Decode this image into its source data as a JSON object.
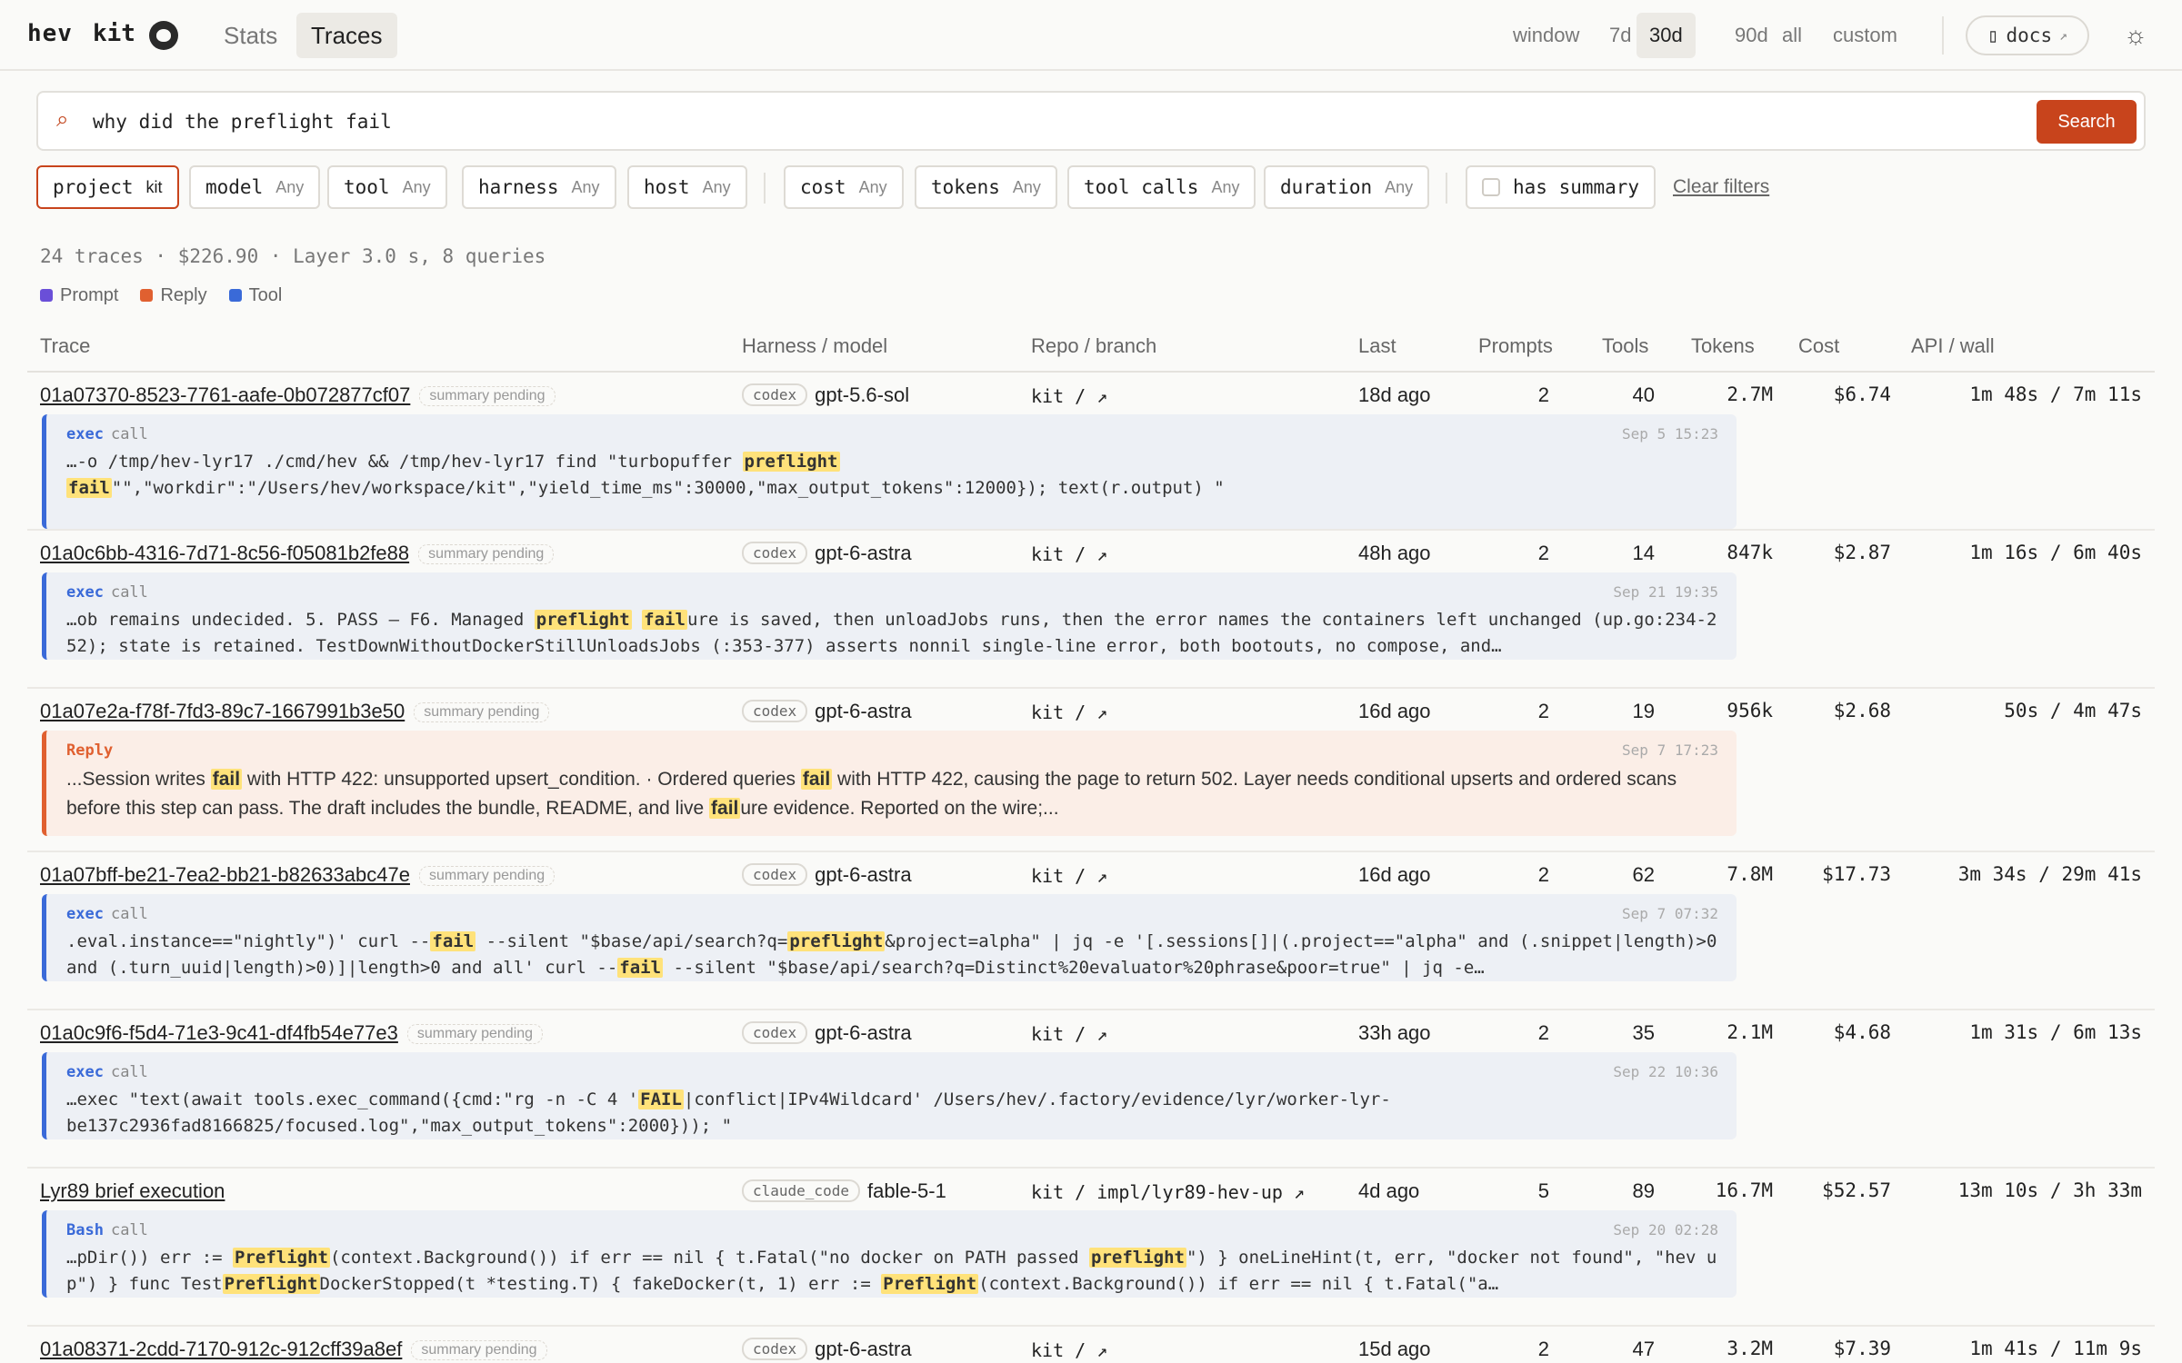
{
  "brand": {
    "name": "hev",
    "project": "kit",
    "github_icon": "github-icon"
  },
  "nav": {
    "stats": "Stats",
    "traces": "Traces"
  },
  "window": {
    "label": "window",
    "options": [
      "7d",
      "30d",
      "90d",
      "all",
      "custom"
    ],
    "active": "30d"
  },
  "docs": {
    "label": "docs",
    "icon": "book-icon",
    "ext": "↗"
  },
  "theme_icon": "sun-icon",
  "search": {
    "value": "why did the preflight fail",
    "button": "Search",
    "icon": "search-icon"
  },
  "filters": [
    {
      "key": "project",
      "value": "kit",
      "active": true
    },
    {
      "key": "model",
      "value": "Any"
    },
    {
      "key": "tool",
      "value": "Any"
    },
    {
      "key": "harness",
      "value": "Any"
    },
    {
      "key": "host",
      "value": "Any"
    },
    {
      "key": "cost",
      "value": "Any"
    },
    {
      "key": "tokens",
      "value": "Any"
    },
    {
      "key": "tool calls",
      "value": "Any"
    },
    {
      "key": "duration",
      "value": "Any"
    }
  ],
  "has_summary": "has summary",
  "clear_filters": "Clear filters",
  "summary": "24 traces · $226.90 · Layer 3.0 s, 8 queries",
  "legend": [
    {
      "label": "Prompt",
      "color": "#6a4fd8"
    },
    {
      "label": "Reply",
      "color": "#e06030"
    },
    {
      "label": "Tool",
      "color": "#3a6ad8"
    }
  ],
  "columns": [
    "Trace",
    "Harness / model",
    "Repo / branch",
    "Last",
    "Prompts",
    "Tools",
    "Tokens",
    "Cost",
    "API / wall"
  ],
  "rows": [
    {
      "id": "01a07370-8523-7761-aafe-0b072877cf07",
      "pending": "summary pending",
      "harness": "codex",
      "model": "gpt-5.6-sol",
      "repo": "kit / ↗",
      "last": "18d ago",
      "prompts": "2",
      "tools": "40",
      "tokens": "2.7M",
      "cost": "$6.74",
      "time": "1m 48s / 7m 11s",
      "snippet": {
        "kind": "exec",
        "sub": "call",
        "ts": "Sep 5 15:23",
        "reply": false,
        "text": [
          "…-o /tmp/hev-lyr17 ./cmd/hev && /tmp/hev-lyr17 find \"turbopuffer ",
          {
            "h": "preflight"
          },
          "\n",
          {
            "h": "fail"
          },
          "\"\",\"workdir\":\"/Users/hev/workspace/kit\",\"yield_time_ms\":30000,\"max_output_tokens\":12000}); text(r.output) \""
        ]
      }
    },
    {
      "id": "01a0c6bb-4316-7d71-8c56-f05081b2fe88",
      "pending": "summary pending",
      "harness": "codex",
      "model": "gpt-6-astra",
      "repo": "kit / ↗",
      "last": "48h ago",
      "prompts": "2",
      "tools": "14",
      "tokens": "847k",
      "cost": "$2.87",
      "time": "1m 16s / 6m 40s",
      "snippet": {
        "kind": "exec",
        "sub": "call",
        "ts": "Sep 21 19:35",
        "reply": false,
        "text": [
          "…ob remains undecided. 5. PASS — F6. Managed ",
          {
            "h": "preflight"
          },
          " ",
          {
            "h": "fail"
          },
          "ure is saved, then unloadJobs runs, then the error names the containers left unchanged (up.go:234-252); state is retained. TestDownWithoutDockerStillUnloadsJobs (:353-377) asserts nonnil single-line error, both bootouts, no compose, and…"
        ]
      }
    },
    {
      "id": "01a07e2a-f78f-7fd3-89c7-1667991b3e50",
      "pending": "summary pending",
      "harness": "codex",
      "model": "gpt-6-astra",
      "repo": "kit / ↗",
      "last": "16d ago",
      "prompts": "2",
      "tools": "19",
      "tokens": "956k",
      "cost": "$2.68",
      "time": "50s / 4m 47s",
      "snippet": {
        "kind": "Reply",
        "sub": "",
        "ts": "Sep 7 17:23",
        "reply": true,
        "text": [
          "...Session writes ",
          {
            "h": "fail"
          },
          " with HTTP 422: unsupported upsert_condition. · Ordered queries ",
          {
            "h": "fail"
          },
          " with HTTP 422, causing the page to return 502. Layer needs conditional upserts and ordered scans before this step can pass. The draft includes the bundle, README, and live ",
          {
            "h": "fail"
          },
          "ure evidence. Reported on the wire;..."
        ]
      }
    },
    {
      "id": "01a07bff-be21-7ea2-bb21-b82633abc47e",
      "pending": "summary pending",
      "harness": "codex",
      "model": "gpt-6-astra",
      "repo": "kit / ↗",
      "last": "16d ago",
      "prompts": "2",
      "tools": "62",
      "tokens": "7.8M",
      "cost": "$17.73",
      "time": "3m 34s / 29m 41s",
      "snippet": {
        "kind": "exec",
        "sub": "call",
        "ts": "Sep 7 07:32",
        "reply": false,
        "text": [
          ".eval.instance==\"nightly\")' curl --",
          {
            "h": "fail"
          },
          " --silent \"$base/api/search?q=",
          {
            "h": "preflight"
          },
          "&project=alpha\" | jq -e '[.sessions[]|(.project==\"alpha\" and (.snippet|length)>0 and (.turn_uuid|length)>0)]|length>0 and all' curl --",
          {
            "h": "fail"
          },
          " --silent \"$base/api/search?q=Distinct%20evaluator%20phrase&poor=true\" | jq -e…"
        ]
      }
    },
    {
      "id": "01a0c9f6-f5d4-71e3-9c41-df4fb54e77e3",
      "pending": "summary pending",
      "harness": "codex",
      "model": "gpt-6-astra",
      "repo": "kit / ↗",
      "last": "33h ago",
      "prompts": "2",
      "tools": "35",
      "tokens": "2.1M",
      "cost": "$4.68",
      "time": "1m 31s / 6m 13s",
      "snippet": {
        "kind": "exec",
        "sub": "call",
        "ts": "Sep 22 10:36",
        "reply": false,
        "text": [
          "…exec \"text(await tools.exec_command({cmd:\"rg -n -C 4 '",
          {
            "h": "FAIL"
          },
          "|conflict|IPv4Wildcard' /Users/hev/.factory/evidence/lyr/worker-lyr-\nbe137c2936fad8166825/focused.log\",\"max_output_tokens\":2000})); \""
        ]
      }
    },
    {
      "id": "Lyr89 brief execution",
      "pending": "",
      "harness": "claude_code",
      "model": "fable-5-1",
      "repo": "kit / impl/lyr89-hev-up ↗",
      "last": "4d ago",
      "prompts": "5",
      "tools": "89",
      "tokens": "16.7M",
      "cost": "$52.57",
      "time": "13m 10s / 3h 33m",
      "snippet": {
        "kind": "Bash",
        "sub": "call",
        "ts": "Sep 20 02:28",
        "reply": false,
        "text": [
          "…pDir()) err := ",
          {
            "h": "Preflight"
          },
          "(context.Background()) if err == nil { t.Fatal(\"no docker on PATH passed ",
          {
            "h": "preflight"
          },
          "\") } oneLineHint(t, err, \"docker not found\", \"hev up\") } func Test",
          {
            "h": "Preflight"
          },
          "DockerStopped(t *testing.T) { fakeDocker(t, 1) err := ",
          {
            "h": "Preflight"
          },
          "(context.Background()) if err == nil { t.Fatal(\"a…"
        ]
      }
    },
    {
      "id": "01a08371-2cdd-7170-912c-912cff39a8ef",
      "pending": "summary pending",
      "harness": "codex",
      "model": "gpt-6-astra",
      "repo": "kit / ↗",
      "last": "15d ago",
      "prompts": "2",
      "tools": "47",
      "tokens": "3.2M",
      "cost": "$7.39",
      "time": "1m 41s / 11m 9s",
      "snippet": null
    }
  ]
}
